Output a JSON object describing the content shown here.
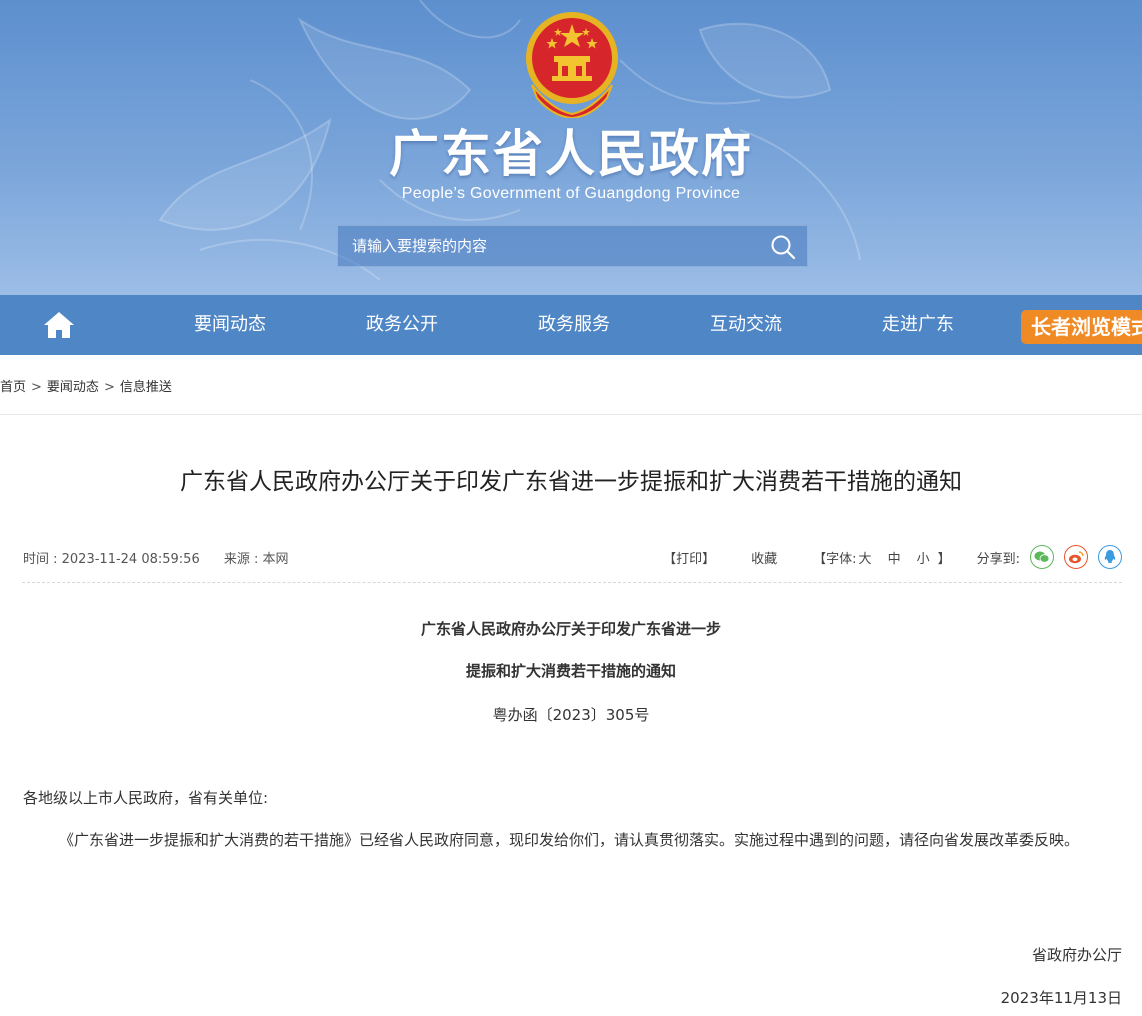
{
  "header": {
    "title": "广东省人民政府",
    "subtitle": "People’s Government of Guangdong Province",
    "search_placeholder": "请输入要搜索的内容",
    "colors": {
      "banner": "#5d8fce",
      "nav": "#4f86c6",
      "elder": "#f08a24"
    }
  },
  "nav": {
    "home_icon": "home-icon",
    "items": [
      "要闻动态",
      "政务公开",
      "政务服务",
      "互动交流",
      "走进广东"
    ],
    "elder_mode": "长者浏览模式"
  },
  "breadcrumb": [
    "首页",
    "要闻动态",
    "信息推送"
  ],
  "article": {
    "title": "广东省人民政府办公厅关于印发广东省进一步提振和扩大消费若干措施的通知",
    "time": "时间 : 2023-11-24 08:59:56",
    "source": "来源 : 本网",
    "tools": {
      "print": "【打印】",
      "favorite": "收藏",
      "font_label": "【字体: ",
      "font_sizes": [
        "大",
        "中",
        "小"
      ],
      "font_end": " 】",
      "share_label": "分享到:"
    },
    "doc_title_line1": "广东省人民政府办公厅关于印发广东省进一步",
    "doc_title_line2": "提振和扩大消费若干措施的通知",
    "doc_number": "粤办函〔2023〕305号",
    "salutation": "各地级以上市人民政府，省有关单位:",
    "body": "《广东省进一步提振和扩大消费的若干措施》已经省人民政府同意，现印发给你们，请认真贯彻落实。实施过程中遇到的问题，请径向省发展改革委反映。",
    "signer": "省政府办公厅",
    "date": "2023年11月13日"
  }
}
